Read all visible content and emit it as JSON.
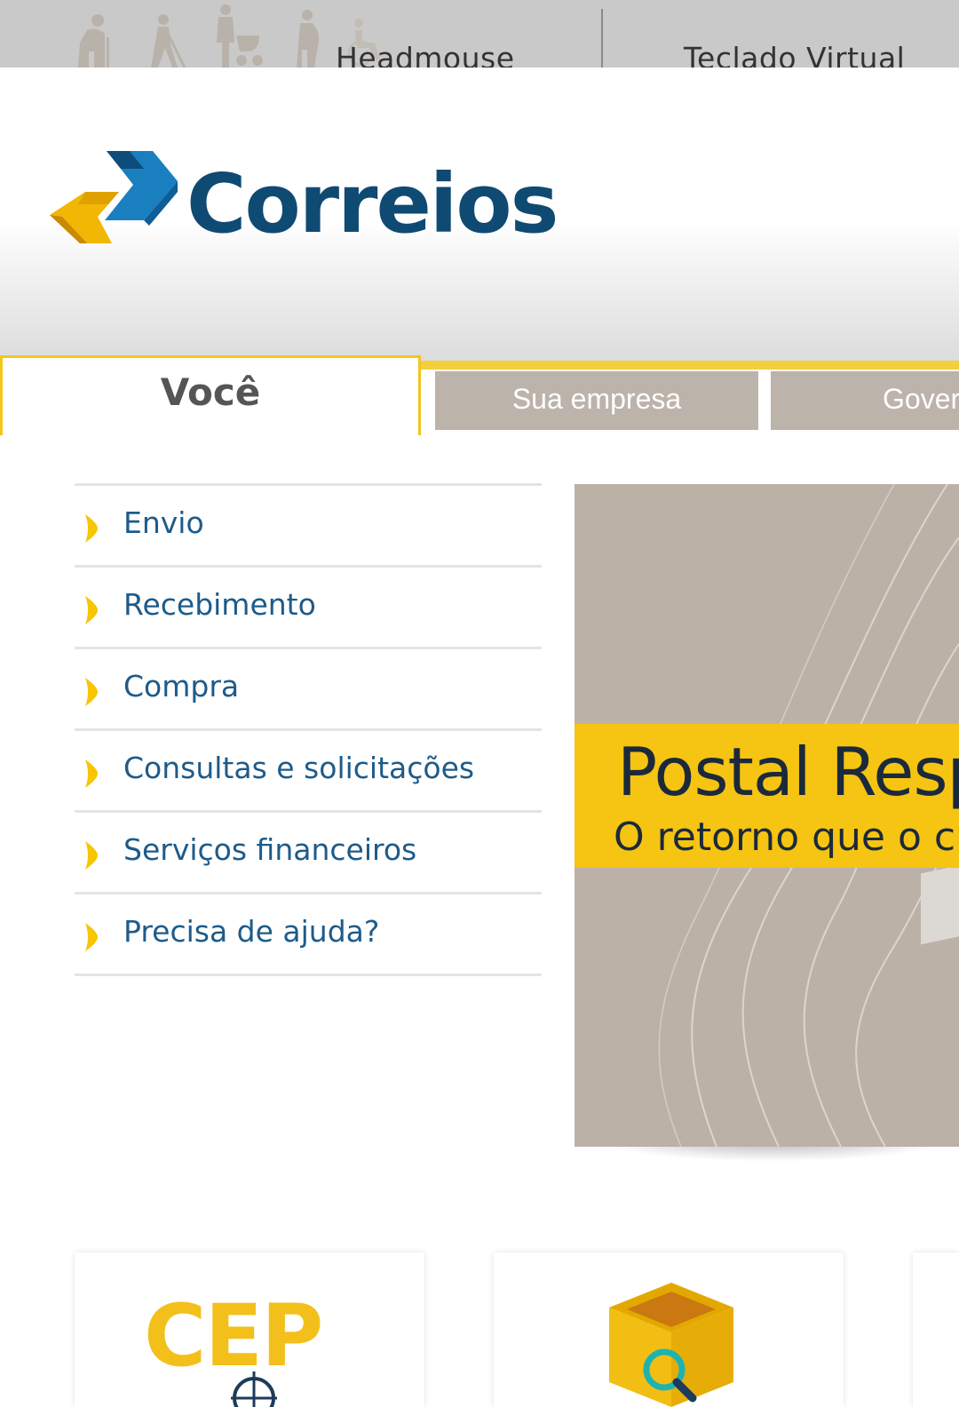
{
  "accessibility_bar": {
    "icons": [
      "elderly-person-icon",
      "blind-person-icon",
      "parent-with-stroller-icon",
      "pregnant-person-icon",
      "wheelchair-icon"
    ],
    "links": [
      {
        "label": "Headmouse"
      },
      {
        "label": "Teclado Virtual"
      }
    ]
  },
  "header": {
    "logo_text": "Correios"
  },
  "tabs": [
    {
      "label": "Você",
      "active": true
    },
    {
      "label": "Sua empresa",
      "active": false
    },
    {
      "label": "Gover",
      "active": false
    }
  ],
  "menu": {
    "items": [
      {
        "label": "Envio"
      },
      {
        "label": "Recebimento"
      },
      {
        "label": "Compra"
      },
      {
        "label": "Consultas e solicitações"
      },
      {
        "label": "Serviços financeiros"
      },
      {
        "label": "Precisa de ajuda?"
      }
    ]
  },
  "banner": {
    "title": "Postal Resp",
    "subtitle": "O retorno que o clie"
  },
  "tiles": [
    {
      "label": "CEP"
    },
    {
      "icon": "package-search-icon"
    }
  ],
  "colors": {
    "brand_blue": "#0f4a73",
    "brand_yellow": "#f2c61c",
    "link_blue": "#1d5b8a",
    "tab_gray": "#bcb3aa"
  }
}
